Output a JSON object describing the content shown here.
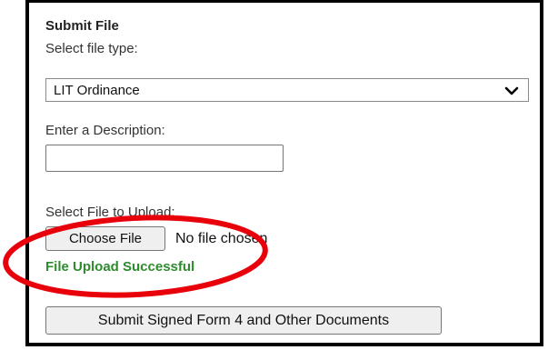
{
  "form": {
    "title": "Submit File",
    "file_type_label": "Select file type:",
    "file_type_selected": "LIT Ordinance",
    "description_label": "Enter a Description:",
    "description_value": "",
    "upload_label": "Select File to Upload:",
    "choose_file_label": "Choose File",
    "no_file_text": "No file chosen",
    "status_message": "File Upload Successful",
    "submit_label": "Submit Signed Form 4 and Other Documents"
  },
  "colors": {
    "success": "#2e8b2e",
    "annotation": "#e8000b",
    "panel_border": "#000000"
  },
  "icons": {
    "select_arrow": "chevron-down-icon"
  }
}
